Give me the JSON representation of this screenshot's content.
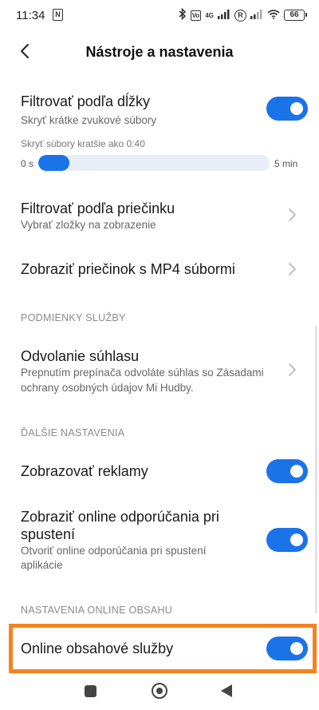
{
  "status_bar": {
    "time": "11:34",
    "nfc_badge": "N",
    "bluetooth_icon": "bluetooth-icon",
    "volte_badge": "Vo",
    "network_type": "4G",
    "r_badge": "R",
    "battery": "66"
  },
  "header": {
    "back_icon": "chevron-left-icon",
    "title": "Nástroje a nastavenia"
  },
  "filter_length": {
    "title": "Filtrovať podľa dĺžky",
    "subtitle": "Skryť krátke zvukové súbory",
    "enabled": true,
    "slider_caption": "Skryť súbory kratšie ako 0:40",
    "slider_min": "0 s",
    "slider_max": "5 min",
    "slider_fraction": 0.133
  },
  "filter_folder": {
    "title": "Filtrovať podľa priečinku",
    "subtitle": "Vybrať zložky na zobrazenie"
  },
  "mp4_folder": {
    "title": "Zobraziť priečinok s MP4 súbormi"
  },
  "terms_section": {
    "label": "PODMIENKY SLUŽBY"
  },
  "consent": {
    "title": "Odvolanie súhlasu",
    "subtitle_line1": "Prepnutím prepínača odvoláte súhlas so Zásadami",
    "subtitle_line2": "ochrany osobných údajov Mi Hudby."
  },
  "more_section": {
    "label": "ĎALŠIE NASTAVENIA"
  },
  "ads": {
    "title": "Zobrazovať reklamy",
    "enabled": true
  },
  "online_recs": {
    "title_line1": "Zobraziť online odporúčania pri",
    "title_line2": "spustení",
    "subtitle_line1": "Otvoriť online odporúčania pri spustení",
    "subtitle_line2": "aplikácie",
    "enabled": true
  },
  "online_section": {
    "label": "NASTAVENIA ONLINE OBSAHU"
  },
  "online_services": {
    "title": "Online obsahové služby",
    "enabled": true
  },
  "colors": {
    "accent": "#1a73e8",
    "highlight": "#f5821f"
  }
}
